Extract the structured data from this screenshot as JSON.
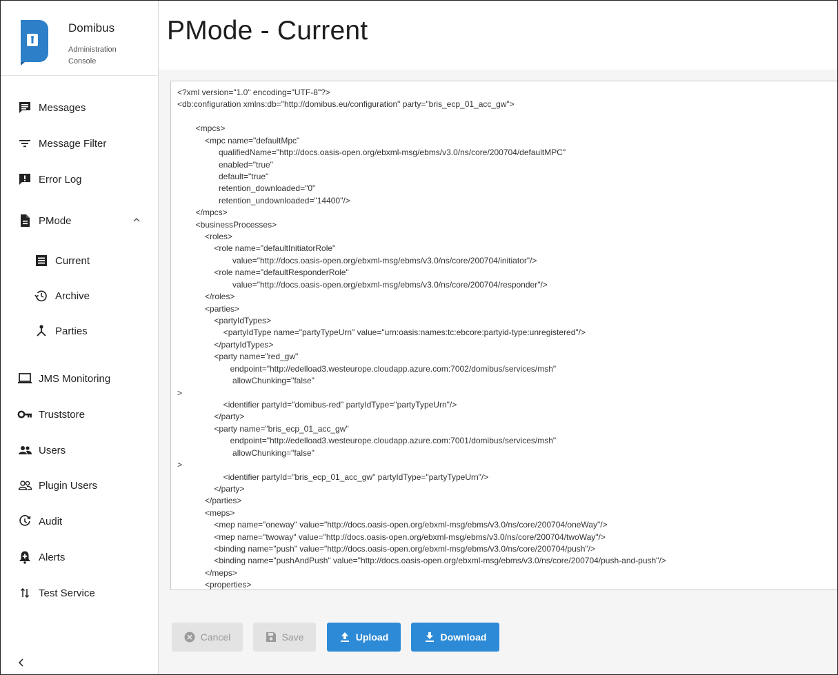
{
  "brand": {
    "title": "Domibus",
    "subtitle": "Administration Console"
  },
  "page": {
    "title": "PMode - Current"
  },
  "sidebar": {
    "items": [
      {
        "label": "Messages",
        "icon": "message-icon"
      },
      {
        "label": "Message Filter",
        "icon": "filter-icon"
      },
      {
        "label": "Error Log",
        "icon": "error-log-icon"
      },
      {
        "label": "PMode",
        "icon": "document-icon",
        "expanded": true
      },
      {
        "label": "Current",
        "icon": "list-icon"
      },
      {
        "label": "Archive",
        "icon": "history-icon"
      },
      {
        "label": "Parties",
        "icon": "parties-icon"
      },
      {
        "label": "JMS Monitoring",
        "icon": "laptop-icon"
      },
      {
        "label": "Truststore",
        "icon": "key-icon"
      },
      {
        "label": "Users",
        "icon": "users-icon"
      },
      {
        "label": "Plugin Users",
        "icon": "plugin-users-icon"
      },
      {
        "label": "Audit",
        "icon": "audit-icon"
      },
      {
        "label": "Alerts",
        "icon": "alert-icon"
      },
      {
        "label": "Test Service",
        "icon": "swap-icon"
      }
    ]
  },
  "editor": {
    "content": "<?xml version=\"1.0\" encoding=\"UTF-8\"?>\n<db:configuration xmlns:db=\"http://domibus.eu/configuration\" party=\"bris_ecp_01_acc_gw\">\n\n        <mpcs>\n            <mpc name=\"defaultMpc\"\n                  qualifiedName=\"http://docs.oasis-open.org/ebxml-msg/ebms/v3.0/ns/core/200704/defaultMPC\"\n                  enabled=\"true\"\n                  default=\"true\"\n                  retention_downloaded=\"0\"\n                  retention_undownloaded=\"14400\"/>\n        </mpcs>\n        <businessProcesses>\n            <roles>\n                <role name=\"defaultInitiatorRole\"\n                        value=\"http://docs.oasis-open.org/ebxml-msg/ebms/v3.0/ns/core/200704/initiator\"/>\n                <role name=\"defaultResponderRole\"\n                        value=\"http://docs.oasis-open.org/ebxml-msg/ebms/v3.0/ns/core/200704/responder\"/>\n            </roles>\n            <parties>\n                <partyIdTypes>\n                    <partyIdType name=\"partyTypeUrn\" value=\"urn:oasis:names:tc:ebcore:partyid-type:unregistered\"/>\n                </partyIdTypes>\n                <party name=\"red_gw\"\n                       endpoint=\"http://edelload3.westeurope.cloudapp.azure.com:7002/domibus/services/msh\"\n                        allowChunking=\"false\"\n>\n                    <identifier partyId=\"domibus-red\" partyIdType=\"partyTypeUrn\"/>\n                </party>\n                <party name=\"bris_ecp_01_acc_gw\"\n                       endpoint=\"http://edelload3.westeurope.cloudapp.azure.com:7001/domibus/services/msh\"\n                        allowChunking=\"false\"\n>\n                    <identifier partyId=\"bris_ecp_01_acc_gw\" partyIdType=\"partyTypeUrn\"/>\n                </party>\n            </parties>\n            <meps>\n                <mep name=\"oneway\" value=\"http://docs.oasis-open.org/ebxml-msg/ebms/v3.0/ns/core/200704/oneWay\"/>\n                <mep name=\"twoway\" value=\"http://docs.oasis-open.org/ebxml-msg/ebms/v3.0/ns/core/200704/twoWay\"/>\n                <binding name=\"push\" value=\"http://docs.oasis-open.org/ebxml-msg/ebms/v3.0/ns/core/200704/push\"/>\n                <binding name=\"pushAndPush\" value=\"http://docs.oasis-open.org/ebxml-msg/ebms/v3.0/ns/core/200704/push-and-push\"/>\n            </meps>\n            <properties>\n                <property name=\"originalSenderProperty\""
  },
  "buttons": {
    "cancel": "Cancel",
    "save": "Save",
    "upload": "Upload",
    "download": "Download"
  },
  "colors": {
    "primary": "#2d8ad6",
    "brand": "#2d7fc8",
    "disabled": "#e3e3e3"
  }
}
